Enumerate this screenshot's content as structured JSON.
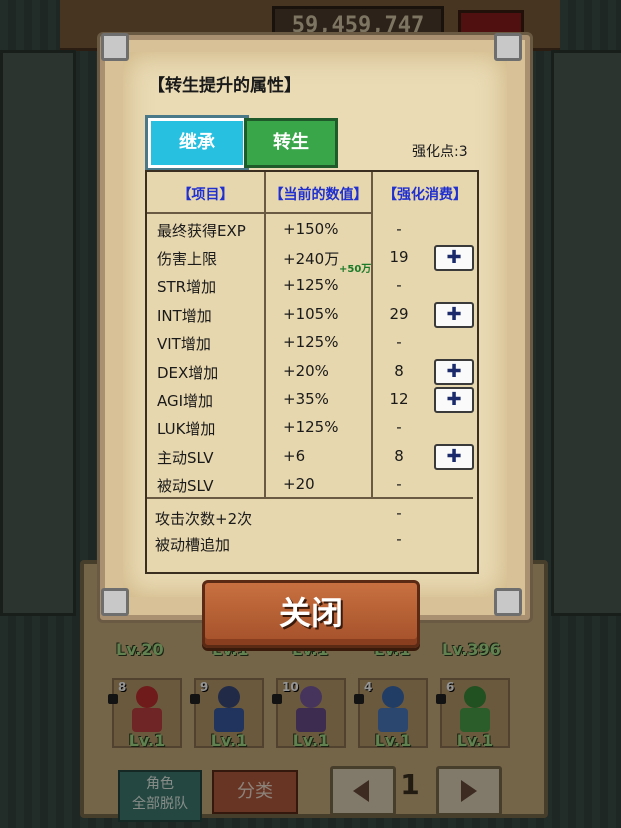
{
  "hud": {
    "gold": "59,459,747"
  },
  "dialog": {
    "title": "【转生提升的属性】",
    "tabs": {
      "inherit": "继承",
      "rebirth": "转生"
    },
    "points_label": "强化点:3",
    "columns": {
      "item": "【项目】",
      "current": "【当前的数值】",
      "cost": "【强化消费】"
    },
    "rows": [
      {
        "label": "最终获得EXP",
        "value": "+150%",
        "bonus": "",
        "cost": "-",
        "upgradable": false
      },
      {
        "label": "伤害上限",
        "value": "+240万",
        "bonus": "+50万",
        "cost": "19",
        "upgradable": true
      },
      {
        "label": "STR增加",
        "value": "+125%",
        "bonus": "",
        "cost": "-",
        "upgradable": false
      },
      {
        "label": "INT增加",
        "value": "+105%",
        "bonus": "",
        "cost": "29",
        "upgradable": true
      },
      {
        "label": "VIT增加",
        "value": "+125%",
        "bonus": "",
        "cost": "-",
        "upgradable": false
      },
      {
        "label": "DEX增加",
        "value": "+20%",
        "bonus": "",
        "cost": "8",
        "upgradable": true
      },
      {
        "label": "AGI增加",
        "value": "+35%",
        "bonus": "",
        "cost": "12",
        "upgradable": true
      },
      {
        "label": "LUK增加",
        "value": "+125%",
        "bonus": "",
        "cost": "-",
        "upgradable": false
      },
      {
        "label": "主动SLV",
        "value": "+6",
        "bonus": "",
        "cost": "8",
        "upgradable": true
      },
      {
        "label": "被动SLV",
        "value": "+20",
        "bonus": "",
        "cost": "-",
        "upgradable": false
      }
    ],
    "extras": [
      {
        "label": "攻击次数+2次",
        "cost": "-"
      },
      {
        "label": "被动槽追加",
        "cost": "-"
      }
    ],
    "plus_symbol": "✚",
    "close_label": "关闭"
  },
  "roster": {
    "top_levels": [
      "Lv.20",
      "Lv.1",
      "Lv.1",
      "Lv.1",
      "Lv.396"
    ],
    "slots": [
      {
        "num": "8",
        "level": "Lv.1",
        "head": "#c03030",
        "body": "#c04040"
      },
      {
        "num": "9",
        "level": "Lv.1",
        "head": "#3a4a7a",
        "body": "#3a5aa0"
      },
      {
        "num": "10",
        "level": "Lv.1",
        "head": "#7a5aa0",
        "body": "#6a4a8a"
      },
      {
        "num": "4",
        "level": "Lv.1",
        "head": "#3a6ab0",
        "body": "#4a7ac0"
      },
      {
        "num": "6",
        "level": "Lv.1",
        "head": "#3a8a3a",
        "body": "#4aa04a"
      }
    ]
  },
  "bottom_bar": {
    "role_line1": "角色",
    "role_line2": "全部脱队",
    "sort_label": "分类",
    "page": "1"
  }
}
